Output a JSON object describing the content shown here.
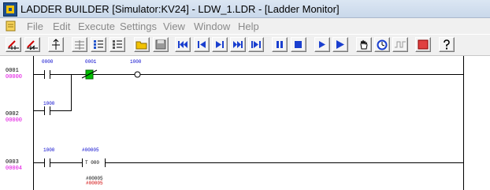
{
  "window": {
    "title": "LADDER BUILDER   [Simulator:KV24] - LDW_1.LDR - [Ladder Monitor]"
  },
  "menu": {
    "items": [
      "File",
      "Edit",
      "Execute",
      "Settings",
      "View",
      "Window",
      "Help"
    ]
  },
  "toolbar": {
    "buttons": [
      "contact-no-icon",
      "contact-nc-icon",
      "insert-vertical-icon",
      "align-icon",
      "list-icon",
      "list-alt-icon",
      "open-folder-icon",
      "save-icon",
      "first-icon",
      "prev-icon",
      "step-icon",
      "next-icon",
      "last-icon",
      "pause-icon",
      "stop-icon",
      "play-icon",
      "run-icon",
      "hand-icon",
      "timer-icon",
      "wave-icon",
      "red-square-icon",
      "help-icon"
    ]
  },
  "colors": {
    "address": "#0000cc",
    "step": "#e000e0",
    "active": "#00aa00",
    "current": "#d00000"
  },
  "rungs": [
    {
      "number": "0001",
      "step": "00000"
    },
    {
      "number": "0002",
      "step": "00000"
    },
    {
      "number": "0003",
      "step": "00004"
    }
  ],
  "labels": {
    "r1_c1": "0000",
    "r1_c2": "0001",
    "r1_coil": "1000",
    "r2_c1": "1000",
    "r3_c1": "1000",
    "r3_t_addr": "#00005",
    "r3_timer": "T 000",
    "r3_val1": "#00005",
    "r3_val2": "#00005"
  }
}
